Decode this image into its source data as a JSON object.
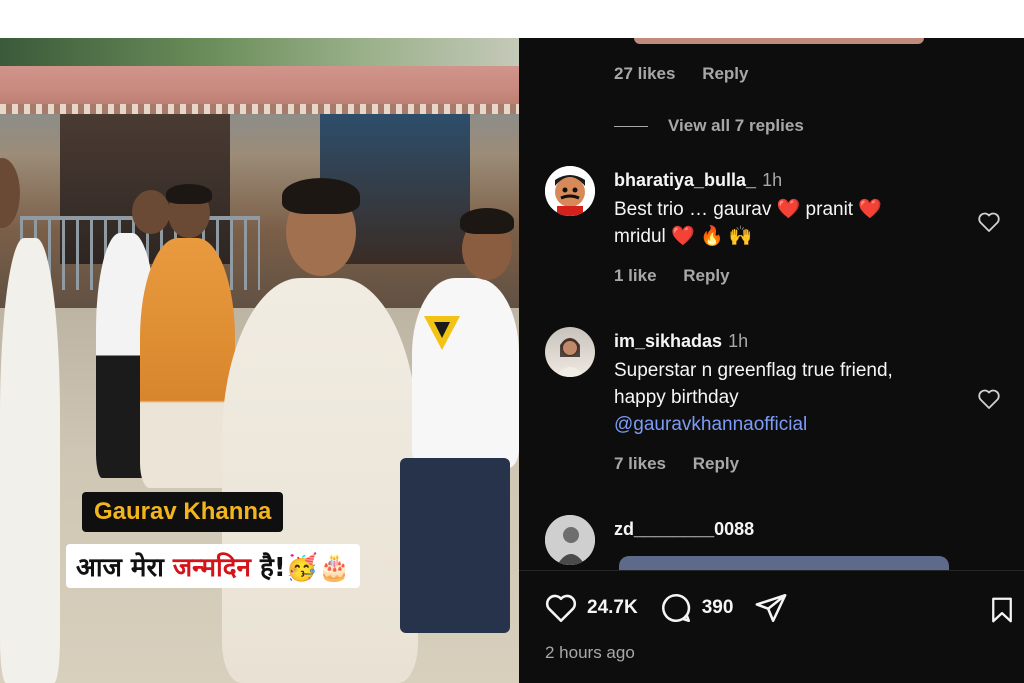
{
  "video": {
    "name_tag": "Gaurav Khanna",
    "caption_prefix": "आज मेरा ",
    "caption_highlight": "जन्मदिन",
    "caption_suffix": " है!",
    "caption_emojis": "🥳🎂"
  },
  "previous_comment": {
    "likes": "27 likes",
    "reply_label": "Reply",
    "view_replies": "View all 7 replies"
  },
  "comments": [
    {
      "username": "bharatiya_bulla_",
      "time": "1h",
      "text_line1": "Best trio … gaurav ❤️ pranit ❤️",
      "text_line2": "mridul ❤️  🔥 🙌",
      "likes": "1 like",
      "reply_label": "Reply"
    },
    {
      "username": "im_sikhadas",
      "time": "1h",
      "text_line1": "Superstar n greenflag true friend,",
      "text_line2": "happy birthday",
      "mention": "@gauravkhannaofficial",
      "likes": "7 likes",
      "reply_label": "Reply"
    },
    {
      "username": "zd________0088"
    }
  ],
  "actions": {
    "like_count": "24.7K",
    "comment_count": "390"
  },
  "post_time": "2 hours ago",
  "colors": {
    "panel_bg": "#0d0d0d",
    "text_primary": "#f5f5f5",
    "text_secondary": "#a8a8a8",
    "mention": "#7c9cf6",
    "tag_gold": "#f2b51e",
    "tag_red": "#d4141b"
  },
  "icons": [
    "heart-icon",
    "comment-icon",
    "share-icon",
    "bookmark-icon"
  ]
}
